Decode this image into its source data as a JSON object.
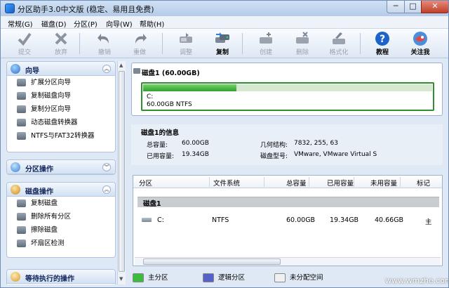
{
  "window": {
    "title": "分区助手3.0中文版 (稳定、易用且免费)",
    "min": "─",
    "max": "□",
    "close": "✕"
  },
  "menu": [
    "常规(G)",
    "磁盘(D)",
    "分区(P)",
    "向导(W)",
    "帮助(H)"
  ],
  "toolbar": [
    {
      "label": "提交",
      "icon": "check-icon",
      "state": "dim"
    },
    {
      "label": "放弃",
      "icon": "x-icon",
      "state": "dim"
    },
    {
      "label": "撤销",
      "icon": "undo-icon",
      "state": "dim"
    },
    {
      "label": "重做",
      "icon": "redo-icon",
      "state": "dim"
    },
    {
      "label": "调整",
      "icon": "resize-icon",
      "state": "dim"
    },
    {
      "label": "复制",
      "icon": "copy-disk-icon",
      "state": "on"
    },
    {
      "label": "创建",
      "icon": "create-icon",
      "state": "dim"
    },
    {
      "label": "删除",
      "icon": "delete-icon",
      "state": "dim"
    },
    {
      "label": "格式化",
      "icon": "format-icon",
      "state": "dim"
    },
    {
      "label": "教程",
      "icon": "help-icon",
      "state": "on"
    },
    {
      "label": "关注我",
      "icon": "follow-icon",
      "state": "on"
    }
  ],
  "sidebar": {
    "wizard": {
      "title": "向导",
      "items": [
        "扩展分区向导",
        "复制磁盘向导",
        "复制分区向导",
        "动态磁盘转换器",
        "NTFS与FAT32转换器"
      ]
    },
    "partition_ops": {
      "title": "分区操作"
    },
    "disk_ops": {
      "title": "磁盘操作",
      "items": [
        "复制磁盘",
        "删除所有分区",
        "擦除磁盘",
        "坏扇区检测"
      ]
    },
    "pending": {
      "title": "等待执行的操作"
    }
  },
  "disk": {
    "title": "磁盘1 (60.00GB)",
    "partition_label": "C:",
    "partition_desc": "60.00GB NTFS",
    "used_fraction": 0.3225
  },
  "info": {
    "title": "磁盘1的信息",
    "total_label": "总容量:",
    "total": "60.00GB",
    "used_label": "已用容量:",
    "used": "19.34GB",
    "geometry_label": "几何结构:",
    "geometry": "7832, 255, 63",
    "model_label": "磁盘型号:",
    "model": "VMware, VMware Virtual S"
  },
  "table": {
    "headers": [
      "分区",
      "文件系统",
      "总容量",
      "已用容量",
      "未用容量",
      "标记"
    ],
    "group": "磁盘1",
    "row": {
      "partition": "C:",
      "fs": "NTFS",
      "total": "60.00GB",
      "used": "19.34GB",
      "free": "40.66GB",
      "flag": "主"
    }
  },
  "legend": [
    {
      "label": "主分区",
      "color": "#3dbb3d"
    },
    {
      "label": "逻辑分区",
      "color": "#5560c8"
    },
    {
      "label": "未分配空间",
      "color": "#f0f0f0"
    }
  ],
  "watermark": "www.wmzhe.com"
}
